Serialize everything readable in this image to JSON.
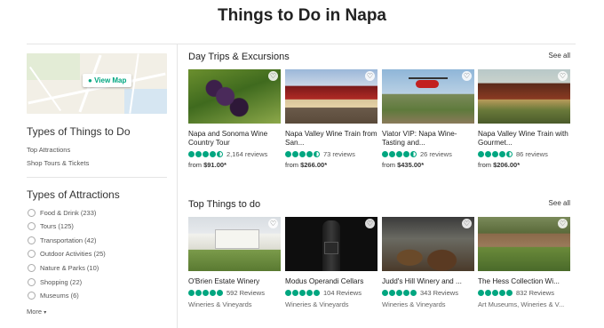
{
  "page_title": "Things to Do in Napa",
  "map": {
    "button_label": "View Map",
    "pin_icon": "map-pin-icon"
  },
  "sidebar": {
    "types_heading": "Types of Things to Do",
    "types_links": [
      "Top Attractions",
      "Shop Tours & Tickets"
    ],
    "attractions_heading": "Types of Attractions",
    "filters": [
      "Food & Drink (233)",
      "Tours (125)",
      "Transportation (42)",
      "Outdoor Activities (25)",
      "Nature & Parks (10)",
      "Shopping (22)",
      "Museums (6)"
    ],
    "more_label": "More",
    "more_icon": "chevron-down-icon"
  },
  "sections": [
    {
      "title": "Day Trips & Excursions",
      "see_all": "See all",
      "cards": [
        {
          "name": "Napa and Sonoma Wine Country Tour",
          "rating": 4.5,
          "reviews": "2,164 reviews",
          "price_prefix": "from ",
          "price": "$91.00*"
        },
        {
          "name": "Napa Valley Wine Train from San...",
          "rating": 4.5,
          "reviews": "73 reviews",
          "price_prefix": "from ",
          "price": "$266.00*"
        },
        {
          "name": "Viator VIP: Napa Wine-Tasting and...",
          "rating": 4.5,
          "reviews": "26 reviews",
          "price_prefix": "from ",
          "price": "$435.00*"
        },
        {
          "name": "Napa Valley Wine Train with Gourmet...",
          "rating": 4.5,
          "reviews": "86 reviews",
          "price_prefix": "from ",
          "price": "$206.00*"
        }
      ]
    },
    {
      "title": "Top Things to do",
      "see_all": "See all",
      "cards": [
        {
          "name": "O'Brien Estate Winery",
          "rating": 5,
          "reviews": "592 Reviews",
          "category": "Wineries & Vineyards"
        },
        {
          "name": "Modus Operandi Cellars",
          "rating": 5,
          "reviews": "104 Reviews",
          "category": "Wineries & Vineyards"
        },
        {
          "name": "Judd's Hill Winery and ...",
          "rating": 5,
          "reviews": "343 Reviews",
          "category": "Wineries & Vineyards"
        },
        {
          "name": "The Hess Collection Wi...",
          "rating": 5,
          "reviews": "832 Reviews",
          "category": "Art Museums, Wineries & V..."
        }
      ]
    }
  ],
  "colors": {
    "accent": "#00a680"
  }
}
